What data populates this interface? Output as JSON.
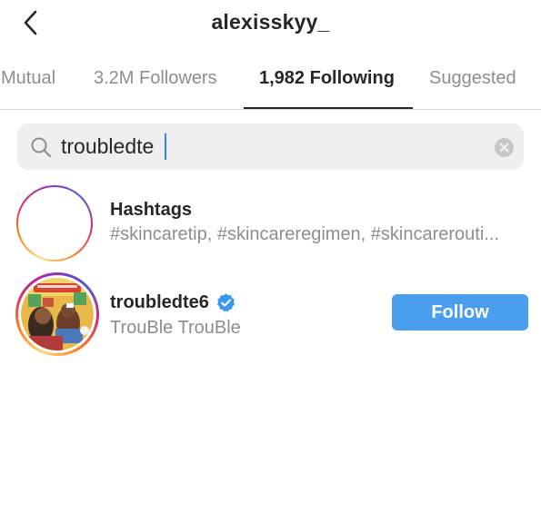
{
  "header": {
    "title": "alexisskyy_",
    "back_icon": "chevron-left-icon"
  },
  "tabs": [
    {
      "label": "Mutual",
      "active": false
    },
    {
      "label": "3.2M Followers",
      "active": false
    },
    {
      "label": "1,982 Following",
      "active": true
    },
    {
      "label": "Suggested",
      "active": false
    }
  ],
  "search": {
    "value": "troubledte",
    "icon": "search-icon",
    "clear_icon": "clear-circle-icon"
  },
  "results": [
    {
      "type": "hashtag",
      "title": "Hashtags",
      "subtitle": "#skincaretip, #skincareregimen, #skincarerouti...",
      "icon": "hashtag-icon"
    },
    {
      "type": "user",
      "username": "troubledte6",
      "verified": true,
      "display_name": "TrouBle TrouBle",
      "action_label": "Follow",
      "avatar": "cartoon-avatar"
    }
  ],
  "colors": {
    "accent": "#4a9eee",
    "text_primary": "#262626",
    "text_secondary": "#8e8e8e",
    "search_bg": "#efefef",
    "verified": "#3897f0"
  }
}
